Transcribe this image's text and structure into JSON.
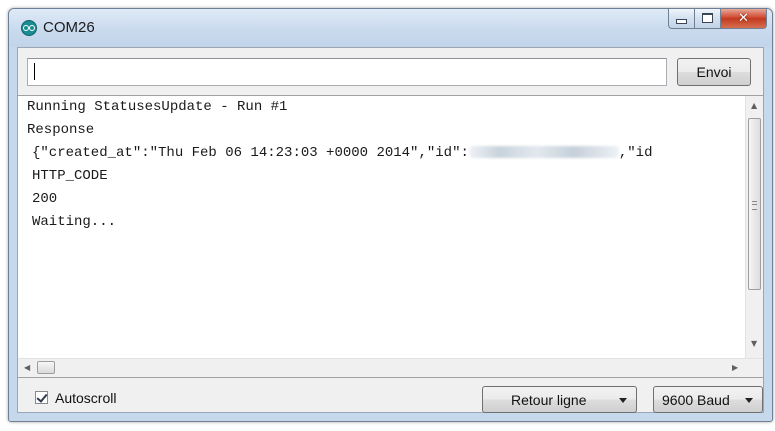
{
  "window": {
    "title": "COM26"
  },
  "toolbar": {
    "input_value": "",
    "send_label": "Envoi"
  },
  "console": {
    "lines": [
      "Running StatusesUpdate - Run #1",
      "Response",
      "{\"created_at\":\"Thu Feb 06 14:23:03 +0000 2014\",\"id\":",
      "HTTP_CODE",
      "200",
      "Waiting..."
    ],
    "line3_tail": ",\"id"
  },
  "footer": {
    "autoscroll_label": "Autoscroll",
    "autoscroll_checked": true,
    "line_ending": "Retour ligne",
    "baud_rate": "9600 Baud"
  },
  "icons": {
    "app": "arduino-icon",
    "minimize": "minimize-icon",
    "maximize": "maximize-icon",
    "close": "close-icon"
  },
  "colors": {
    "close_button": "#c9452a",
    "titlebar": "#c9daee"
  }
}
